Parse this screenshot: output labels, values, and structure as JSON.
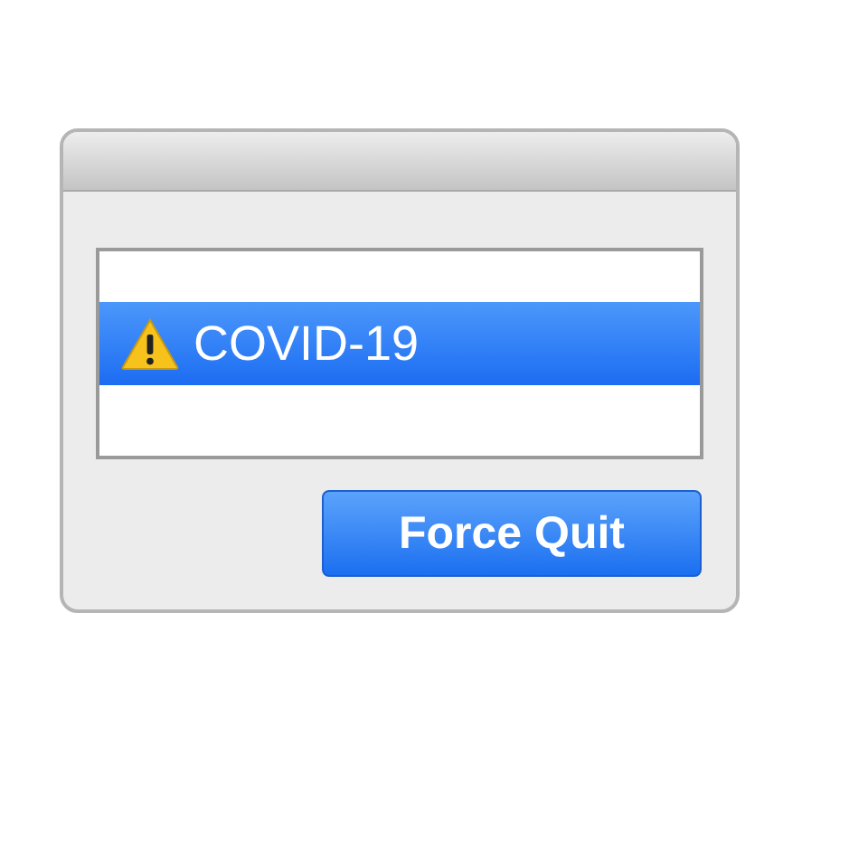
{
  "list": {
    "items": [
      {
        "label": "COVID-19",
        "selected": true
      }
    ]
  },
  "button": {
    "label": "Force Quit"
  }
}
